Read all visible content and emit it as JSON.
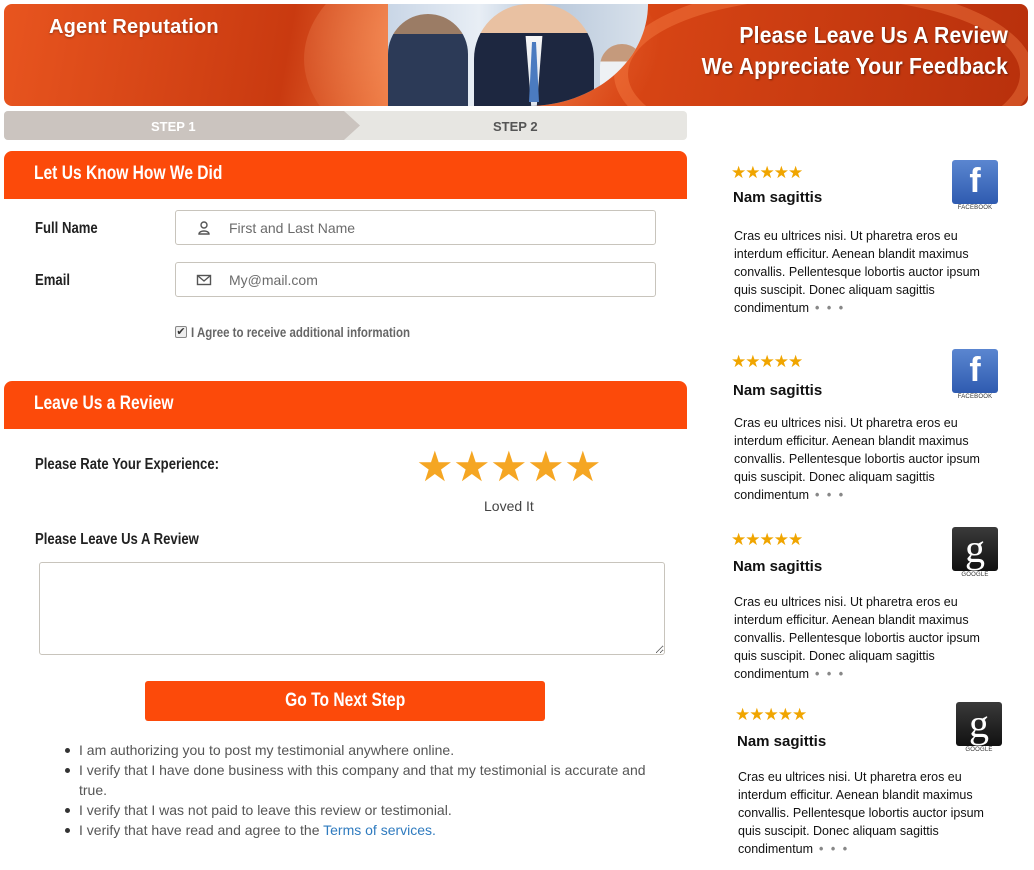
{
  "header": {
    "brand": "Agent Reputation",
    "line1": "Please Leave Us A Review",
    "line2": "We Appreciate Your Feedback"
  },
  "steps": [
    "STEP 1",
    "STEP 2"
  ],
  "colors": {
    "accent": "#fc4a0a",
    "star": "#f5a623",
    "link": "#2f7bbf"
  },
  "contact_section": {
    "title": "Let Us Know How We Did",
    "full_name_label": "Full Name",
    "full_name_placeholder": "First and Last Name",
    "email_label": "Email",
    "email_placeholder": "My@mail.com",
    "agree_label": "I Agree to receive additional information",
    "agree_checked": true
  },
  "review_section": {
    "title": "Leave Us a Review",
    "rate_label": "Please Rate Your Experience:",
    "rating": 5,
    "rating_caption": "Loved It",
    "review_label": "Please Leave Us A Review",
    "review_value": "",
    "next_button": "Go To Next Step"
  },
  "terms": {
    "items": [
      "I am authorizing you to post my testimonial anywhere online.",
      "I verify that I have done business with this company and that my testimonial is accurate and true.",
      "I verify that I was not paid to leave this review or testimonial.",
      "I verify that have read and agree to the "
    ],
    "link_text": "Terms of services."
  },
  "reviews": [
    {
      "stars": "★★★★★",
      "name": "Nam sagittis",
      "source": "FACEBOOK",
      "source_icon": "facebook-icon",
      "body": "Cras eu ultrices nisi. Ut pharetra eros eu interdum efficitur. Aenean blandit maximus convallis. Pellentesque lobortis auctor ipsum quis suscipit. Donec aliquam sagittis condimentum",
      "more": "• • •"
    },
    {
      "stars": "★★★★★",
      "name": "Nam sagittis",
      "source": "FACEBOOK",
      "source_icon": "facebook-icon",
      "body": "Cras eu ultrices nisi. Ut pharetra eros eu interdum efficitur. Aenean blandit maximus convallis. Pellentesque lobortis auctor ipsum quis suscipit. Donec aliquam sagittis condimentum",
      "more": "• • •"
    },
    {
      "stars": "★★★★★",
      "name": "Nam sagittis",
      "source": "GOOGLE",
      "source_icon": "google-icon",
      "body": "Cras eu ultrices nisi. Ut pharetra eros eu interdum efficitur. Aenean blandit maximus convallis. Pellentesque lobortis auctor ipsum quis suscipit. Donec aliquam sagittis condimentum",
      "more": "• • •"
    },
    {
      "stars": "★★★★★",
      "name": "Nam sagittis",
      "source": "GOOGLE",
      "source_icon": "google-icon",
      "body": "Cras eu ultrices nisi. Ut pharetra eros eu interdum efficitur. Aenean blandit maximus convallis. Pellentesque lobortis auctor ipsum quis suscipit. Donec aliquam sagittis condimentum",
      "more": "• • •"
    }
  ]
}
